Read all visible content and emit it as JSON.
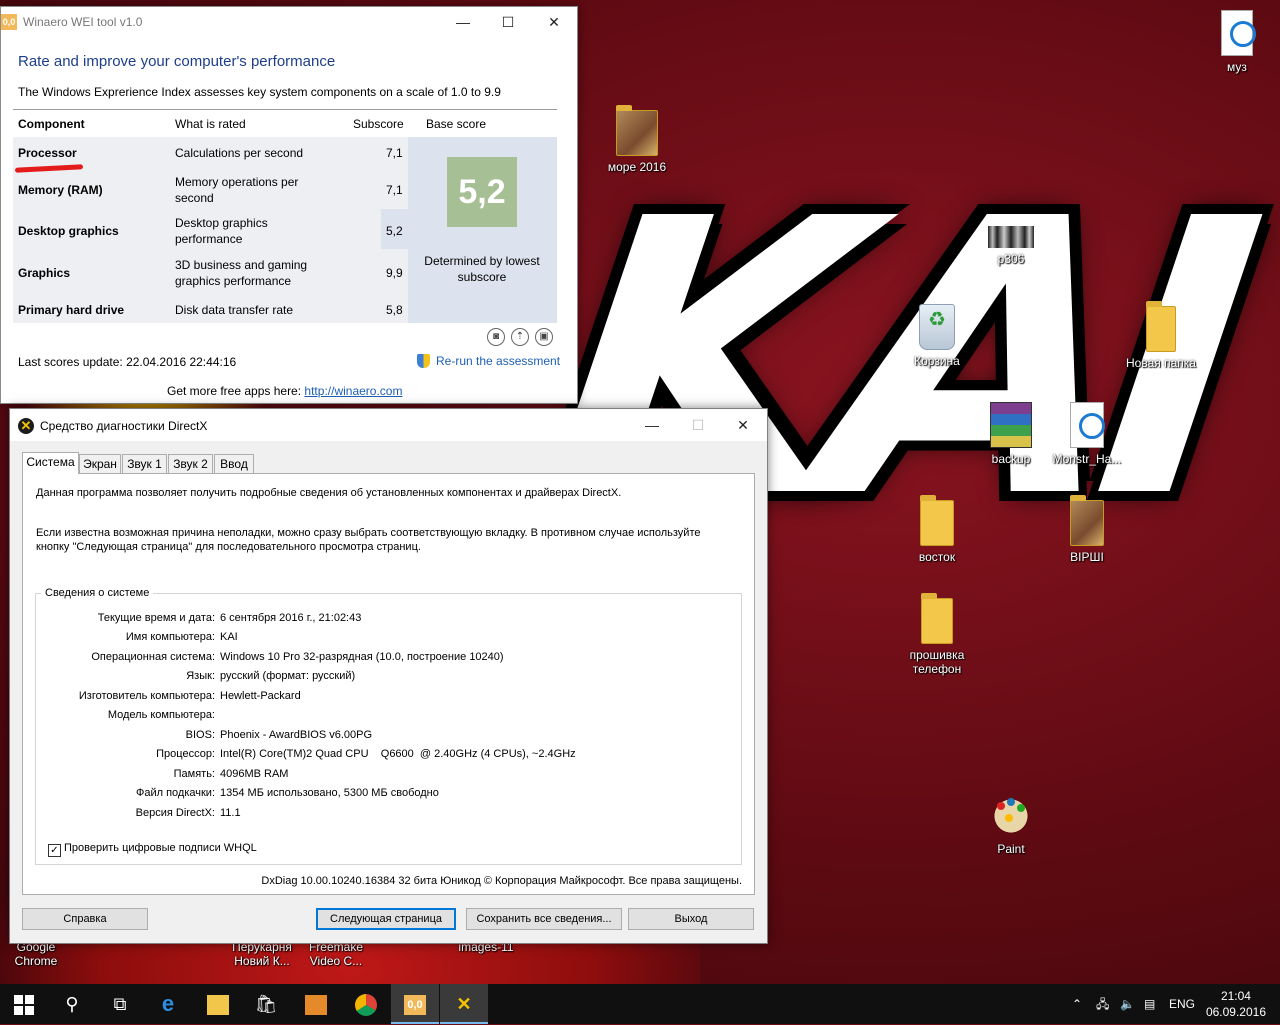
{
  "desktop": {
    "wallpaper_text": "KAI",
    "icons": [
      {
        "label": "муз"
      },
      {
        "label": "море 2016"
      },
      {
        "label": "p306"
      },
      {
        "label": "Корзина"
      },
      {
        "label": "Новая папка"
      },
      {
        "label": "backup"
      },
      {
        "label": "Monstr_Ha..."
      },
      {
        "label": "восток"
      },
      {
        "label": "ВІРШІ"
      },
      {
        "label": "прошивка телефон"
      },
      {
        "label": "Paint"
      },
      {
        "label": "Google Chrome"
      },
      {
        "label": "Перукарня Новий К..."
      },
      {
        "label": "Freemake Video C..."
      },
      {
        "label": "images-11"
      }
    ]
  },
  "wei": {
    "title": "Winaero WEI tool v1.0",
    "app_icon_text": "0,0",
    "heading": "Rate and improve your computer's performance",
    "description": "The Windows Exprerience Index assesses key system components on a scale of 1.0 to 9.9",
    "columns": [
      "Component",
      "What is rated",
      "Subscore",
      "Base score"
    ],
    "rows": [
      {
        "component": "Processor",
        "rated": "Calculations per second",
        "subscore": "7,1"
      },
      {
        "component": "Memory (RAM)",
        "rated": "Memory operations per second",
        "subscore": "7,1"
      },
      {
        "component": "Desktop graphics",
        "rated": "Desktop graphics performance",
        "subscore": "5,2"
      },
      {
        "component": "Graphics",
        "rated": "3D business and gaming graphics performance",
        "subscore": "9,9"
      },
      {
        "component": "Primary hard drive",
        "rated": "Disk data transfer rate",
        "subscore": "5,8"
      }
    ],
    "base_score": "5,2",
    "determined": "Determined by lowest subscore",
    "last_update": "Last scores update: 22.04.2016 22:44:16",
    "rerun": "Re-run the assessment",
    "free_prefix": "Get more free apps here:",
    "free_link": "http://winaero.com",
    "highlight_color": "#e31b1b",
    "score_color": "#a6bf95"
  },
  "dx": {
    "title": "Средство диагностики DirectX",
    "tabs": [
      "Система",
      "Экран",
      "Звук 1",
      "Звук 2",
      "Ввод"
    ],
    "intro1": "Данная программа позволяет получить подробные сведения об установленных компонентах и драйверах DirectX.",
    "intro2": "Если известна возможная причина неполадки, можно сразу выбрать соответствующую вкладку. В противном случае используйте кнопку \"Следующая страница\" для последовательного просмотра страниц.",
    "group_title": "Сведения о системе",
    "info": [
      {
        "k": "Текущие время и дата:",
        "v": "6 сентября 2016 г., 21:02:43"
      },
      {
        "k": "Имя компьютера:",
        "v": "KAI"
      },
      {
        "k": "Операционная система:",
        "v": "Windows 10 Pro 32-разрядная (10.0, построение 10240)"
      },
      {
        "k": "Язык:",
        "v": "русский (формат: русский)"
      },
      {
        "k": "Изготовитель компьютера:",
        "v": "Hewlett-Packard"
      },
      {
        "k": "Модель компьютера:",
        "v": ""
      },
      {
        "k": "BIOS:",
        "v": "Phoenix - AwardBIOS v6.00PG"
      },
      {
        "k": "Процессор:",
        "v": "Intel(R) Core(TM)2 Quad CPU    Q6600  @ 2.40GHz (4 CPUs), ~2.4GHz"
      },
      {
        "k": "Память:",
        "v": "4096MB RAM"
      },
      {
        "k": "Файл подкачки:",
        "v": "1354 МБ использовано, 5300 МБ свободно"
      },
      {
        "k": "Версия DirectX:",
        "v": "11.1"
      }
    ],
    "whql": "Проверить цифровые подписи WHQL",
    "footer": "DxDiag 10.00.10240.16384 32 бита Юникод  © Корпорация Майкрософт. Все права защищены.",
    "buttons": {
      "help": "Справка",
      "next": "Следующая страница",
      "save": "Сохранить все сведения...",
      "exit": "Выход"
    }
  },
  "taskbar": {
    "lang": "ENG",
    "time": "21:04",
    "date": "06.09.2016",
    "wei_icon_text": "0,0"
  }
}
